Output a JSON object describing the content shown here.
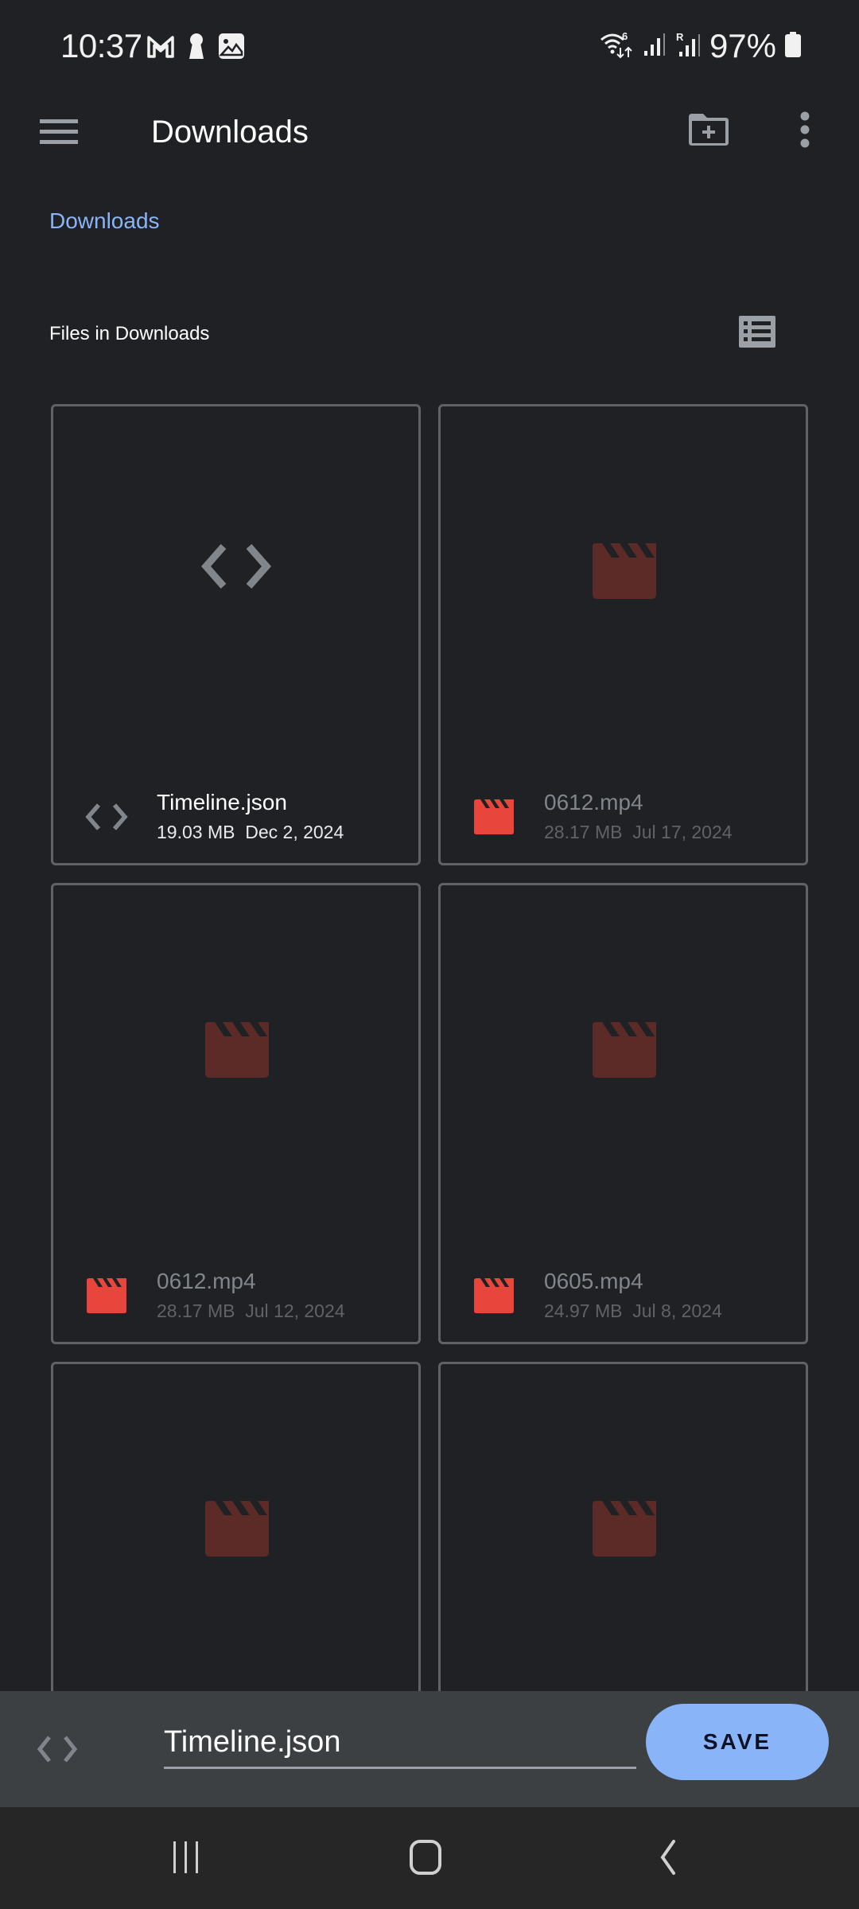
{
  "status_bar": {
    "time": "10:37",
    "notification_icons": [
      "gmail-icon",
      "keyhole-icon",
      "gallery-icon"
    ],
    "system_icons": [
      "wifi6-icon",
      "signal-icon",
      "roaming-signal-icon"
    ],
    "roaming_label": "R",
    "battery_percent": "97%",
    "battery_level": 0.97
  },
  "app_bar": {
    "title": "Downloads",
    "menu_icon": "hamburger-menu-icon",
    "new_folder_icon": "new-folder-icon",
    "more_icon": "more-vert-icon"
  },
  "breadcrumb": {
    "items": [
      "Downloads"
    ]
  },
  "files_section": {
    "header": "Files in Downloads",
    "view_toggle_icon": "list-view-icon"
  },
  "files": [
    {
      "name": "Timeline.json",
      "size": "19.03 MB",
      "date": "Dec 2, 2024",
      "type": "code",
      "enabled": true
    },
    {
      "name": "0612.mp4",
      "size": "28.17 MB",
      "date": "Jul 17, 2024",
      "type": "video",
      "enabled": false
    },
    {
      "name": "0612.mp4",
      "size": "28.17 MB",
      "date": "Jul 12, 2024",
      "type": "video",
      "enabled": false
    },
    {
      "name": "0605.mp4",
      "size": "24.97 MB",
      "date": "Jul 8, 2024",
      "type": "video",
      "enabled": false
    },
    {
      "name": "",
      "size": "",
      "date": "",
      "type": "video",
      "enabled": false
    },
    {
      "name": "",
      "size": "",
      "date": "",
      "type": "video",
      "enabled": false
    }
  ],
  "save_bar": {
    "filename": "Timeline.json",
    "save_label": "SAVE",
    "type_icon": "code-icon"
  },
  "colors": {
    "background": "#202124",
    "accent": "#8ab4f8",
    "card_border": "#5f6368",
    "video_icon": "#e8453c",
    "video_icon_dim": "#5c2a27",
    "save_bar": "#3c4043",
    "nav_bar": "#262626"
  },
  "nav_bar": {
    "buttons": [
      "recents-icon",
      "home-icon",
      "back-icon"
    ]
  }
}
